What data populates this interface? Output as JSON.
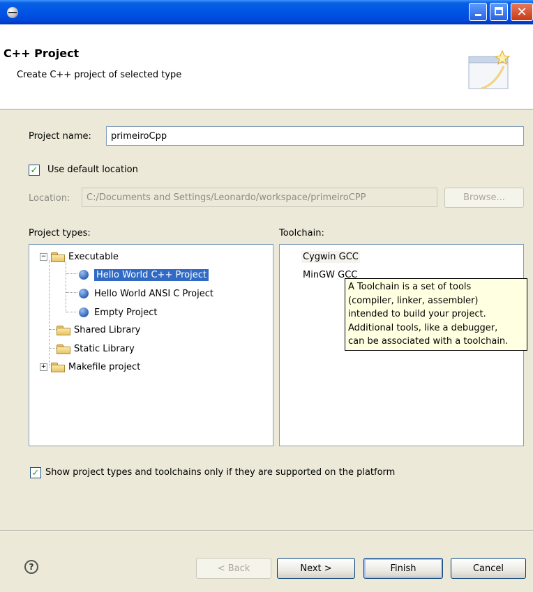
{
  "window": {
    "close_glyph": "✕"
  },
  "header": {
    "title": "C++ Project",
    "description": "Create C++ project of selected type"
  },
  "form": {
    "project_name_label": "Project name:",
    "project_name_value": "primeiroCpp",
    "use_default_location_label": "Use default location",
    "use_default_location_checked": true,
    "location_label": "Location:",
    "location_value": "C:/Documents and Settings/Leonardo/workspace/primeiroCPP",
    "browse_label": "Browse...",
    "check_glyph": "✓"
  },
  "project_types": {
    "label": "Project types:",
    "items": [
      {
        "label": "Executable",
        "expander": "−"
      },
      {
        "label": "Hello World C++ Project",
        "selected": true
      },
      {
        "label": "Hello World ANSI C Project"
      },
      {
        "label": "Empty Project"
      },
      {
        "label": "Shared Library"
      },
      {
        "label": "Static Library"
      },
      {
        "label": "Makefile project",
        "expander": "+"
      }
    ]
  },
  "toolchain": {
    "label": "Toolchain:",
    "items": [
      "Cygwin GCC",
      "MinGW GCC"
    ],
    "tooltip_lines": [
      "A Toolchain is a set of tools",
      "(compiler, linker, assembler)",
      "intended to build your project.",
      "Additional tools, like a debugger,",
      "can be associated with a toolchain."
    ]
  },
  "filter": {
    "label": "Show project types and toolchains only if they are supported on the platform",
    "checked": true
  },
  "footer": {
    "help_glyph": "?",
    "back_label": "< Back",
    "next_label": "Next >",
    "finish_label": "Finish",
    "cancel_label": "Cancel"
  },
  "colors": {
    "titlebar": "#0054E3",
    "selection": "#316AC5",
    "dialog_bg": "#ECE9D8",
    "tooltip_bg": "#FFFFE1"
  }
}
